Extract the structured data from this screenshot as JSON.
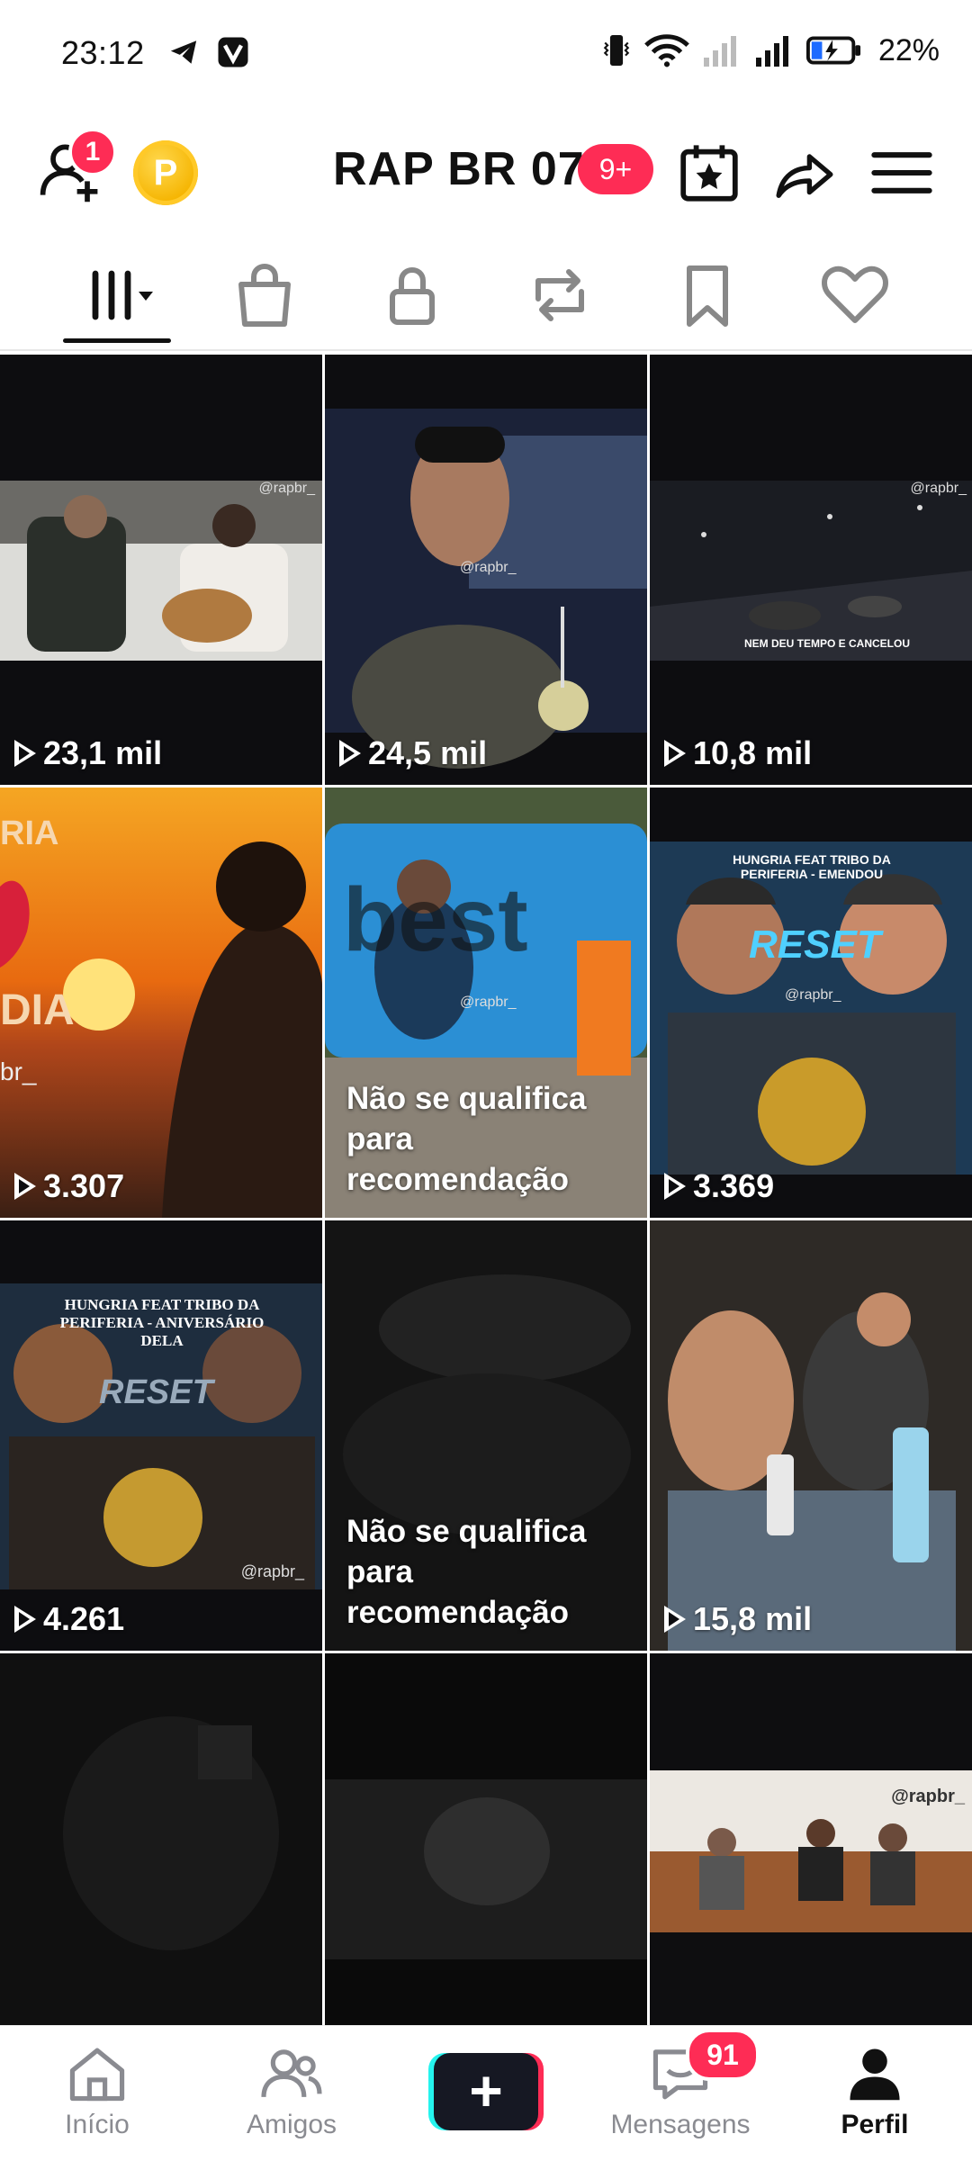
{
  "status_bar": {
    "time": "23:12",
    "battery": "22%",
    "icons": [
      "telegram-icon",
      "v-app-icon",
      "vibrate-icon",
      "wifi-icon",
      "signal-icon",
      "battery-icon"
    ]
  },
  "header": {
    "friend_requests_badge": "1",
    "coin_label": "P",
    "username": "RAP BR 07",
    "notifications_badge": "9+"
  },
  "tabs": [
    {
      "name": "videos",
      "icon": "grid-icon",
      "active": true
    },
    {
      "name": "shop",
      "icon": "bag-icon"
    },
    {
      "name": "private",
      "icon": "lock-icon"
    },
    {
      "name": "reposts",
      "icon": "repost-icon"
    },
    {
      "name": "favorites",
      "icon": "bookmark-icon"
    },
    {
      "name": "liked",
      "icon": "heart-icon"
    }
  ],
  "videos": [
    {
      "views": "23,1 mil",
      "watermark": "@rapbr_"
    },
    {
      "views": "24,5 mil",
      "watermark": "@rapbr_"
    },
    {
      "views": "10,8 mil",
      "watermark": "@rapbr_",
      "caption": "NEM DEU TEMPO E CANCELOU"
    },
    {
      "views": "3.307",
      "overlay_text": "RIA",
      "overlay_text2": "DIA",
      "watermark": "br_"
    },
    {
      "status": "Não se qualifica para recomendação",
      "overlay_text": "best",
      "watermark": "@rapbr_"
    },
    {
      "views": "3.369",
      "title": "HUNGRIA FEAT TRIBO DA PERIFERIA - EMENDOU",
      "logo": "RESET",
      "watermark": "@rapbr_"
    },
    {
      "views": "4.261",
      "title": "HUNGRIA FEAT TRIBO DA PERIFERIA - ANIVERSÁRIO DELA",
      "logo": "RESET",
      "watermark": "@rapbr_"
    },
    {
      "status": "Não se qualifica para recomendação"
    },
    {
      "views": "15,8 mil"
    },
    {},
    {},
    {
      "watermark": "@rapbr_"
    }
  ],
  "bottom_nav": {
    "home": "Início",
    "friends": "Amigos",
    "create": "+",
    "messages": "Mensagens",
    "messages_badge": "91",
    "profile": "Perfil"
  },
  "colors": {
    "accent": "#fe2c55",
    "coin": "#f5b400",
    "text": "#161823",
    "nav_inactive": "#8a8b91"
  }
}
